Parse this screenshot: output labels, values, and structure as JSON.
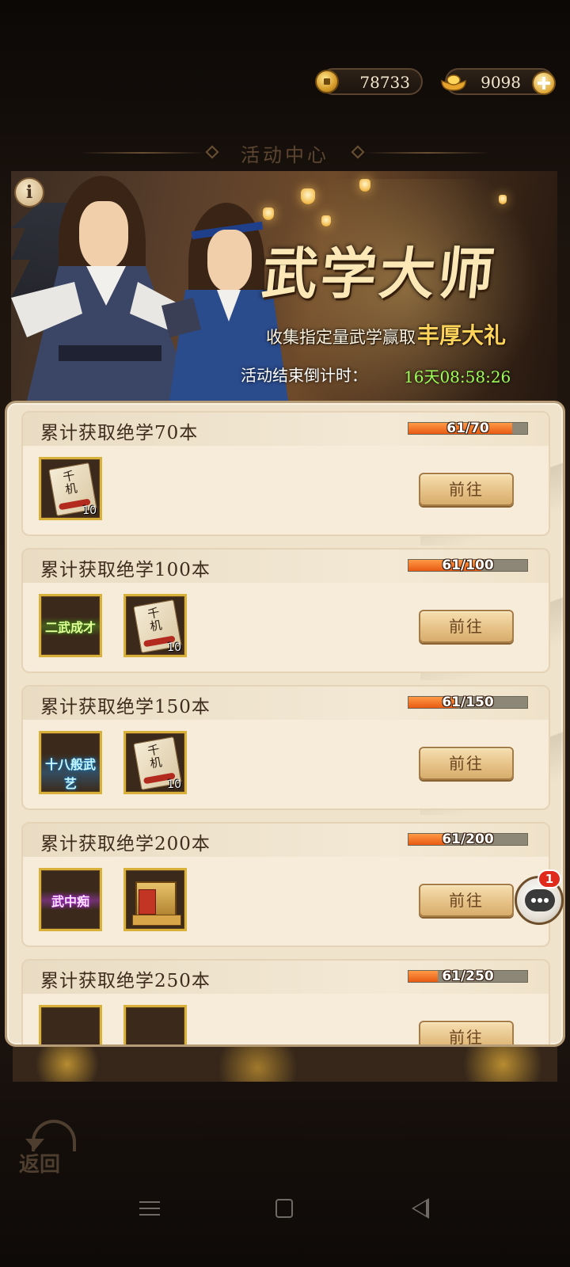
{
  "currency": {
    "coins": "78733",
    "ingots": "9098"
  },
  "page_title": "活动中心",
  "banner": {
    "title": "武学大师",
    "subtitle": "收集指定量武学赢取",
    "subtitle_highlight": "丰厚大礼",
    "countdown_label": "活动结束倒计时：",
    "countdown_value": "16天08:58:26",
    "info_label": "i"
  },
  "tasks": [
    {
      "title": "累计获取绝学70本",
      "progress_text": "61/70",
      "progress": 0.871,
      "rewards": [
        {
          "type": "scroll",
          "glyph": "千机",
          "count": "10"
        }
      ],
      "button": "前往"
    },
    {
      "title": "累计获取绝学100本",
      "progress_text": "61/100",
      "progress": 0.61,
      "rewards": [
        {
          "type": "title",
          "label": "二武成才"
        },
        {
          "type": "scroll",
          "glyph": "千机",
          "count": "10"
        }
      ],
      "button": "前往"
    },
    {
      "title": "累计获取绝学150本",
      "progress_text": "61/150",
      "progress": 0.407,
      "rewards": [
        {
          "type": "title",
          "label": "十八般武艺"
        },
        {
          "type": "scroll",
          "glyph": "千机",
          "count": "10"
        }
      ],
      "button": "前往"
    },
    {
      "title": "累计获取绝学200本",
      "progress_text": "61/200",
      "progress": 0.305,
      "rewards": [
        {
          "type": "title",
          "label": "武中痴"
        },
        {
          "type": "chest"
        }
      ],
      "button": "前往"
    },
    {
      "title": "累计获取绝学250本",
      "progress_text": "61/250",
      "progress": 0.244,
      "rewards": [
        {
          "type": "hidden"
        },
        {
          "type": "hidden"
        }
      ],
      "button": "前往"
    }
  ],
  "chat": {
    "badge": "1"
  },
  "back_label": "返回",
  "colors": {
    "progress_fill": "#e85a14",
    "countdown": "#9cff57",
    "badge": "#e02a1c"
  }
}
